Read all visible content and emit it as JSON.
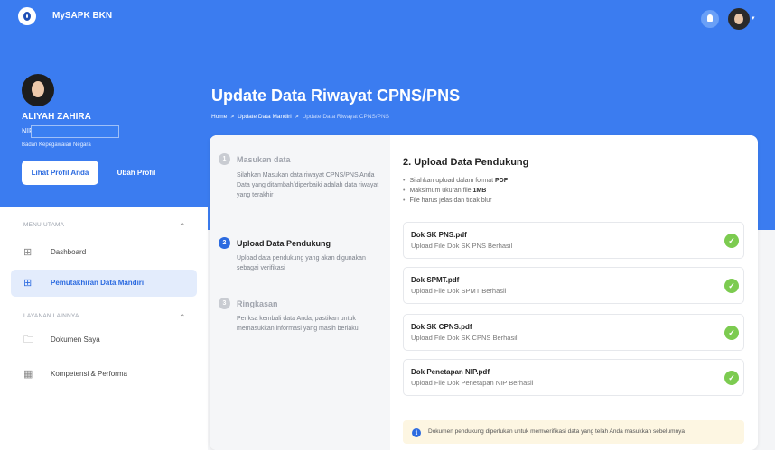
{
  "app": {
    "title": "MySAPK BKN"
  },
  "colors": {
    "primary": "#3b7cf0",
    "accent": "#2c6be0",
    "success": "#7ccb50",
    "note_bg": "#fdf6e2"
  },
  "topbar": {
    "notification_icon": "bell-icon",
    "caret": "▾"
  },
  "profile": {
    "name": "ALIYAH ZAHIRA",
    "nip_label": "NIP",
    "agency": "Badan Kepegawaian Negara",
    "view_profile_button": "Lihat Profil Anda",
    "edit_profile_button": "Ubah Profil"
  },
  "header": {
    "title": "Update Data Riwayat CPNS/PNS",
    "breadcrumb": [
      "Home",
      "Update Data Mandiri",
      "Update Data Riwayat CPNS/PNS"
    ],
    "breadcrumb_sep": ">"
  },
  "sidebar": {
    "sections": [
      {
        "label": "MENU UTAMA",
        "items": [
          {
            "label": "Dashboard",
            "icon": "grid-icon",
            "active": false
          },
          {
            "label": "Pemutakhiran Data Mandiri",
            "icon": "grid-icon",
            "active": true
          }
        ]
      },
      {
        "label": "LAYANAN LAINNYA",
        "items": [
          {
            "label": "Dokumen Saya",
            "icon": "folder-icon",
            "active": false
          },
          {
            "label": "Kompetensi & Performa",
            "icon": "chart-icon",
            "active": false
          }
        ]
      }
    ]
  },
  "steps": [
    {
      "num": "1",
      "title": "Masukan data",
      "desc": "Silahkan Masukan data riwayat CPNS/PNS Anda\nData yang ditambah/diperbaiki adalah data riwayat yang terakhir",
      "active": false
    },
    {
      "num": "2",
      "title": "Upload Data Pendukung",
      "desc": "Upload data pendukung yang akan digunakan sebagai verifikasi",
      "active": true
    },
    {
      "num": "3",
      "title": "Ringkasan",
      "desc": "Periksa kembali data Anda, pastikan untuk memasukkan informasi yang masih berlaku",
      "active": false
    }
  ],
  "upload": {
    "title": "2. Upload Data Pendukung",
    "rules": [
      {
        "text": "Silahkan upload dalam format ",
        "bold": "PDF"
      },
      {
        "text": "Maksimum ukuran file ",
        "bold": "1MB"
      },
      {
        "text": "File harus jelas dan tidak blur",
        "bold": ""
      }
    ],
    "files": [
      {
        "name": "Dok SK PNS.pdf",
        "status": "Upload File Dok SK PNS Berhasil"
      },
      {
        "name": "Dok SPMT.pdf",
        "status": "Upload File Dok SPMT Berhasil"
      },
      {
        "name": "Dok SK CPNS.pdf",
        "status": "Upload File Dok SK CPNS Berhasil"
      },
      {
        "name": "Dok Penetapan NIP.pdf",
        "status": "Upload File Dok Penetapan NIP Berhasil"
      }
    ],
    "note": "Dokumen pendukung diperlukan untuk memverifikasi data yang telah Anda masukkan sebelumnya"
  }
}
